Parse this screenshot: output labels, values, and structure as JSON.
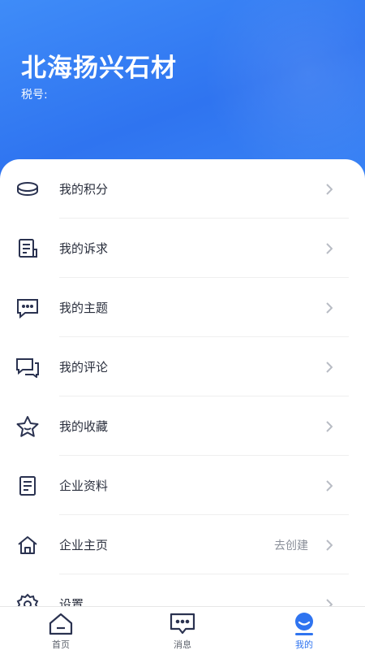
{
  "header": {
    "company_name": "北海扬兴石材",
    "tax_label": "税号:",
    "tax_value": ""
  },
  "menu": {
    "items": [
      {
        "label": "我的积分",
        "icon": "coin-icon"
      },
      {
        "label": "我的诉求",
        "icon": "document-list-icon"
      },
      {
        "label": "我的主题",
        "icon": "chat-dots-icon"
      },
      {
        "label": "我的评论",
        "icon": "comments-icon"
      },
      {
        "label": "我的收藏",
        "icon": "star-icon"
      },
      {
        "label": "企业资料",
        "icon": "file-icon"
      },
      {
        "label": "企业主页",
        "icon": "home-icon",
        "hint": "去创建"
      },
      {
        "label": "设置",
        "icon": "gear-icon"
      }
    ]
  },
  "tabbar": {
    "tabs": [
      {
        "label": "首页",
        "icon": "home-icon"
      },
      {
        "label": "消息",
        "icon": "message-icon"
      },
      {
        "label": "我的",
        "icon": "profile-icon"
      }
    ],
    "active_index": 2
  },
  "colors": {
    "brand": "#2f74f0",
    "icon": "#2a3250",
    "chevron": "#b8bcc4"
  }
}
